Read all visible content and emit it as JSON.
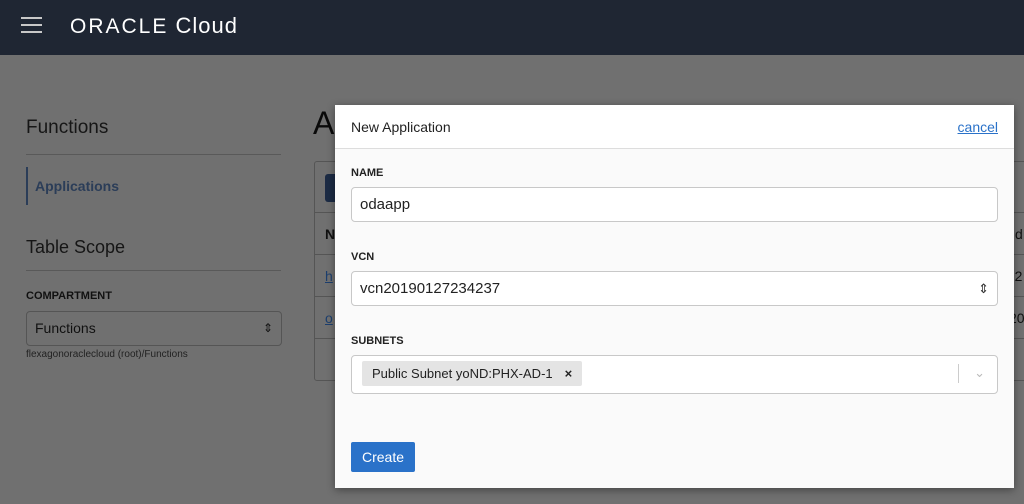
{
  "header": {
    "logo_brand": "ORACLE",
    "logo_product": "Cloud"
  },
  "sidebar": {
    "title": "Functions",
    "items": [
      {
        "label": "Applications"
      }
    ],
    "scope_title": "Table Scope",
    "compartment_label": "COMPARTMENT",
    "compartment_value": "Functions",
    "compartment_path": "flexagonoraclecloud (root)/Functions"
  },
  "background": {
    "title_fragment": "A",
    "table_header_fragment": "N",
    "row_fragments": [
      "h",
      "o"
    ],
    "right_fragments": [
      "d",
      "n 2",
      "20"
    ]
  },
  "modal": {
    "title": "New Application",
    "cancel": "cancel",
    "name_label": "NAME",
    "name_value": "odaapp",
    "vcn_label": "VCN",
    "vcn_value": "vcn20190127234237",
    "subnets_label": "SUBNETS",
    "subnet_chip": "Public Subnet yoND:PHX-AD-1",
    "chip_remove": "×",
    "create_label": "Create"
  },
  "colors": {
    "header": "#1f2633",
    "accent": "#2a72c9"
  }
}
